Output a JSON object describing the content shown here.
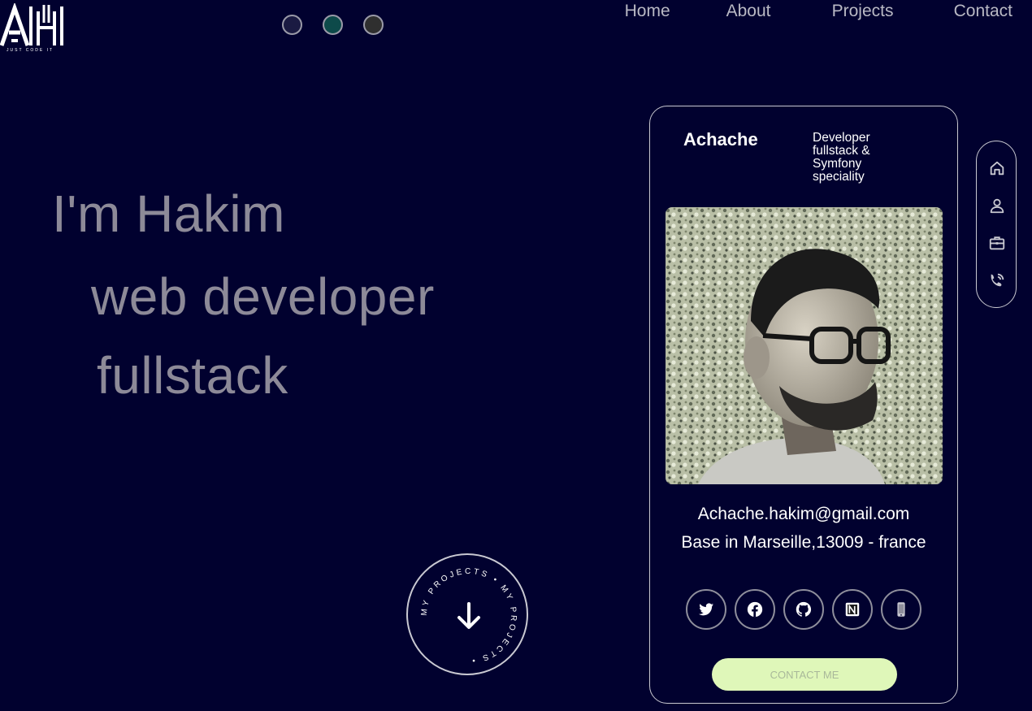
{
  "logo": {
    "mark": "AH",
    "tagline": "JUST CODE IT"
  },
  "theme_dots": [
    {
      "name": "theme-dark-blue",
      "color": "#1a1a42"
    },
    {
      "name": "theme-green",
      "color": "#0d4a4a"
    },
    {
      "name": "theme-gray",
      "color": "#2f2f2f"
    }
  ],
  "nav": {
    "home": "Home",
    "about": "About",
    "projects": "Projects",
    "contact": "Contact"
  },
  "hero": {
    "line1": "I'm Hakim",
    "line2": "web developer",
    "line3": "fullstack"
  },
  "projects_circle": {
    "ring_text": "MY PROJECTS • MY PROJECTS • "
  },
  "card": {
    "name": "Achache",
    "role": "Developer fullstack & Symfony speciality",
    "email": "Achache.hakim@gmail.com",
    "location": "Base in Marseille,13009 - france",
    "socials": [
      "twitter-icon",
      "facebook-icon",
      "github-icon",
      "notion-icon",
      "phone-icon"
    ],
    "contact_button": "CONTACT ME"
  },
  "side_nav": [
    "home-icon",
    "user-icon",
    "briefcase-icon",
    "contact-icon"
  ],
  "colors": {
    "background": "#01012f",
    "hero_text": "#8d8a98",
    "contact_button": "#dff7b9"
  }
}
